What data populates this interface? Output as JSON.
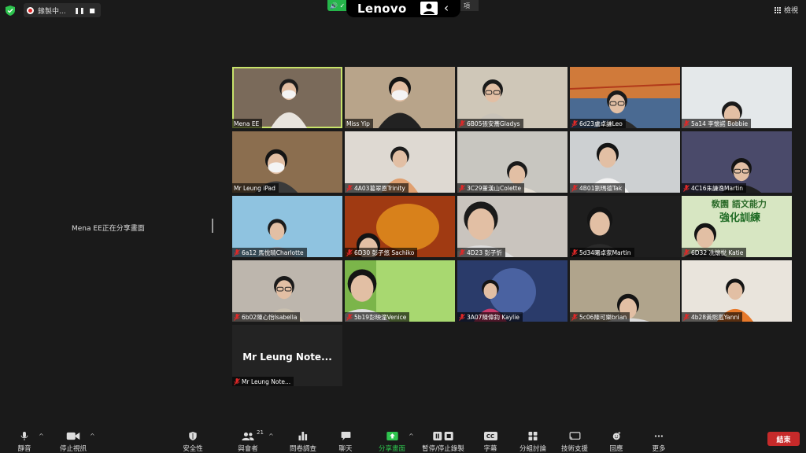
{
  "topbar": {
    "recording_label": "錄製中...",
    "pause_glyph": "❚❚",
    "stop_glyph": "■",
    "green_tag": "🔊 ✓",
    "brand": "Lenovo",
    "chevron": "‹",
    "view_tag": "項",
    "view_label": "檢視"
  },
  "share_status": "Mena  EE正在分享畫面",
  "participants": [
    {
      "name": "Mena  EE",
      "muted": false,
      "bg": "#7a6a5a"
    },
    {
      "name": "Miss Yip",
      "muted": false,
      "bg": "#b8a48a"
    },
    {
      "name": "6B05張安蕎Gladys",
      "muted": true,
      "bg": "#cfc7b8"
    },
    {
      "name": "6d23盧卓謙Leo",
      "muted": true,
      "bg": "#5a7fa8"
    },
    {
      "name": "5a14 李懷諾 Bobbie",
      "muted": true,
      "bg": "#e4e8ea"
    },
    {
      "name": "Mr Leung iPad",
      "muted": false,
      "bg": "#8b6e4f"
    },
    {
      "name": "4A03葛翠恩Trinity",
      "muted": true,
      "bg": "#ded9d2"
    },
    {
      "name": "3C29董漢山Colette",
      "muted": true,
      "bg": "#c8c6c0"
    },
    {
      "name": "4B01劉瑪德Tak",
      "muted": true,
      "bg": "#cdd0d2"
    },
    {
      "name": "4C16朱謙逸Martin",
      "muted": true,
      "bg": "#4a4a6a"
    },
    {
      "name": "6a12 馬悅晴Charlotte",
      "muted": true,
      "bg": "#8fc3e0"
    },
    {
      "name": "6D30 彭子悠 Sachiko",
      "muted": true,
      "bg": "#a03a12"
    },
    {
      "name": "4D23 彭子忻",
      "muted": true,
      "bg": "#c9c4be"
    },
    {
      "name": "5d34曙卓家Martin",
      "muted": true,
      "bg": "#1e1e1e"
    },
    {
      "name": "6D32 冼懷悅 Katie",
      "muted": true,
      "bg": "#d7e6c2"
    },
    {
      "name": "6b02陳心怡Isabella",
      "muted": true,
      "bg": "#bdb6ad"
    },
    {
      "name": "5b19彭映潼Venice",
      "muted": true,
      "bg": "#7bb54a"
    },
    {
      "name": "3A07陳偉鈞 Kaylie",
      "muted": true,
      "bg": "#2a3b6a"
    },
    {
      "name": "5c06陳可樂brian",
      "muted": true,
      "bg": "#b0a48c"
    },
    {
      "name": "4b28黃熙嵐Yanni",
      "muted": true,
      "bg": "#e9e4dc"
    },
    {
      "name": "Mr Leung Note...",
      "muted": true,
      "bg": "#232323",
      "no_video": true
    }
  ],
  "poster": {
    "line1": "敎園 語文能力",
    "line2": "強化訓練"
  },
  "toolbar": {
    "mute": "靜音",
    "stop_video": "停止視訊",
    "security": "安全性",
    "participants": "與會者",
    "participant_count": "21",
    "polls": "問卷調查",
    "chat": "聊天",
    "share": "分享畫面",
    "pause_record": "暫停/停止錄製",
    "cc": "字幕",
    "cc_glyph": "CC",
    "breakout": "分組討論",
    "tech": "技術支援",
    "reactions": "回應",
    "more": "更多",
    "end": "結束",
    "caret": "^"
  },
  "colors": {
    "active_border": "#c7e36a",
    "share_green": "#2ec34e",
    "end_red": "#c62a2a",
    "muted_red": "#e02828"
  }
}
